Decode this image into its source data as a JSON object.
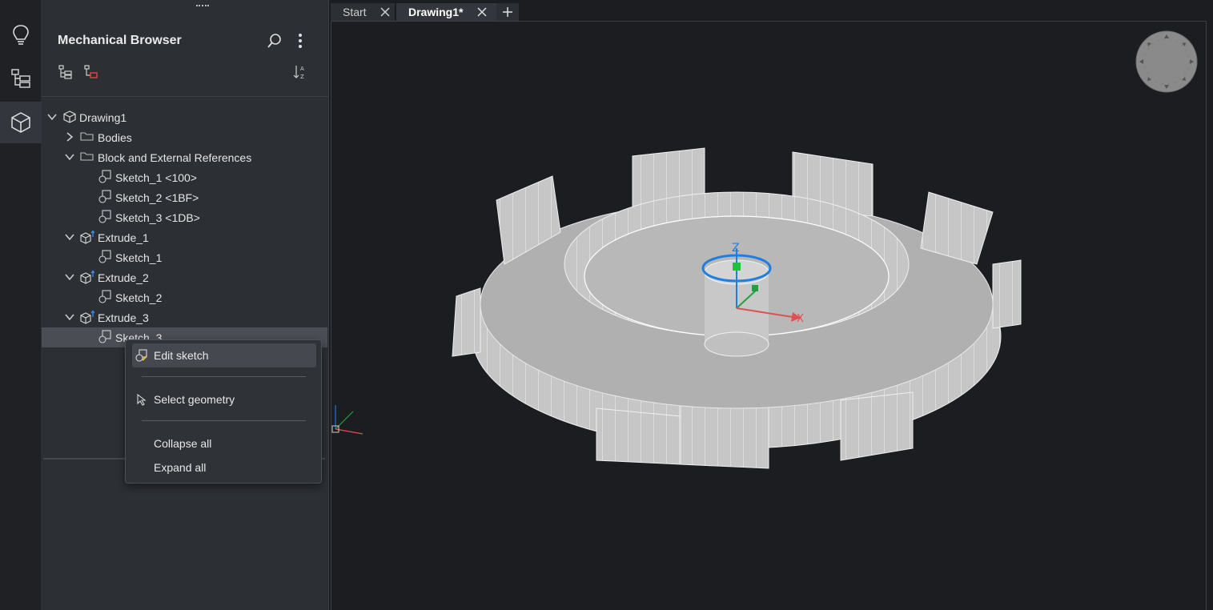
{
  "rail": {
    "items": [
      {
        "name": "hint-lightbulb",
        "active": false
      },
      {
        "name": "structure-tree",
        "active": false
      },
      {
        "name": "mechanical-browser",
        "active": true
      }
    ]
  },
  "panel": {
    "title": "Mechanical Browser"
  },
  "tree": {
    "rows": [
      {
        "label": "Drawing1",
        "level": 0,
        "expanded": true,
        "icon": "drawing-icon"
      },
      {
        "label": "Bodies",
        "level": 1,
        "expanded": false,
        "icon": "folder-icon"
      },
      {
        "label": "Block and External References",
        "level": 1,
        "expanded": true,
        "icon": "folder-icon"
      },
      {
        "label": "Sketch_1 <100>",
        "level": 2,
        "icon": "sketch-icon"
      },
      {
        "label": "Sketch_2 <1BF>",
        "level": 2,
        "icon": "sketch-icon"
      },
      {
        "label": "Sketch_3 <1DB>",
        "level": 2,
        "icon": "sketch-icon"
      },
      {
        "label": "Extrude_1",
        "level": 1,
        "expanded": true,
        "icon": "extrude-icon"
      },
      {
        "label": "Sketch_1",
        "level": 2,
        "icon": "sketch-icon"
      },
      {
        "label": "Extrude_2",
        "level": 1,
        "expanded": true,
        "icon": "extrude-icon"
      },
      {
        "label": "Sketch_2",
        "level": 2,
        "icon": "sketch-icon"
      },
      {
        "label": "Extrude_3",
        "level": 1,
        "expanded": true,
        "icon": "extrude-icon"
      },
      {
        "label": "Sketch_3",
        "level": 2,
        "icon": "sketch-icon",
        "selected": true
      }
    ]
  },
  "context_menu": {
    "edit_sketch": "Edit sketch",
    "select_geometry": "Select geometry",
    "collapse_all": "Collapse all",
    "expand_all": "Expand all"
  },
  "tabs": [
    {
      "label": "Start",
      "active": false
    },
    {
      "label": "Drawing1*",
      "active": true
    }
  ],
  "gizmo": {
    "z_label": "Z",
    "x_label": "X"
  },
  "colors": {
    "accent_blue": "#1e7fe0",
    "axis_green": "#20a040",
    "axis_red": "#e05050",
    "model_fill": "#bdbdbd",
    "selected_row": "#4a4d53"
  }
}
